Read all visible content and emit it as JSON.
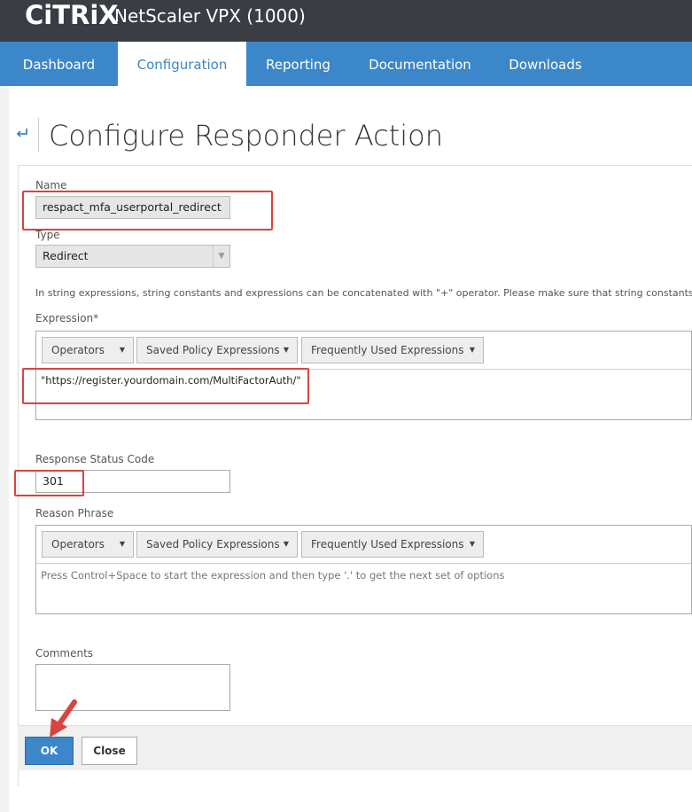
{
  "header": {
    "brand": "CiTRiX",
    "product": "NetScaler VPX (1000)"
  },
  "nav": {
    "tabs": [
      {
        "label": "Dashboard"
      },
      {
        "label": "Configuration"
      },
      {
        "label": "Reporting"
      },
      {
        "label": "Documentation"
      },
      {
        "label": "Downloads"
      }
    ],
    "active": "Configuration"
  },
  "page": {
    "back_icon": "back-arrow-icon",
    "title": "Configure Responder Action"
  },
  "form": {
    "name_label": "Name",
    "name_value": "respact_mfa_userportal_redirect",
    "type_label": "Type",
    "type_value": "Redirect",
    "hint": "In string expressions, string constants and expressions can be concatenated with \"+\" operator. Please make sure that string constants are e",
    "expression_label": "Expression*",
    "expression_value": "\"https://register.yourdomain.com/MultiFactorAuth/\"",
    "toolbar": {
      "operators": "Operators",
      "saved": "Saved Policy Expressions",
      "frequent": "Frequently Used Expressions"
    },
    "status_label": "Response Status Code",
    "status_value": "301",
    "reason_label": "Reason Phrase",
    "reason_placeholder": "Press Control+Space to start the expression and then type '.' to get the next set of options",
    "comments_label": "Comments",
    "comments_value": ""
  },
  "actions": {
    "ok": "OK",
    "close": "Close"
  },
  "colors": {
    "accent": "#3c87c9",
    "topbar": "#3b3d45",
    "highlight": "#d9443f"
  }
}
